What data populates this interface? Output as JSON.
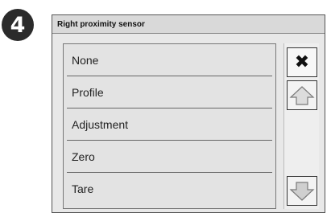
{
  "step_badge": "4",
  "window": {
    "title": "Right proximity sensor"
  },
  "list": {
    "items": [
      {
        "label": "None"
      },
      {
        "label": "Profile"
      },
      {
        "label": "Adjustment"
      },
      {
        "label": "Zero"
      },
      {
        "label": "Tare"
      }
    ]
  },
  "buttons": {
    "close_icon": "close-icon",
    "up_icon": "arrow-up-icon",
    "down_icon": "arrow-down-icon"
  },
  "colors": {
    "badge": "#2b2b2b",
    "window_bg": "#e8e8e8",
    "titlebar": "#d9d9d9"
  }
}
